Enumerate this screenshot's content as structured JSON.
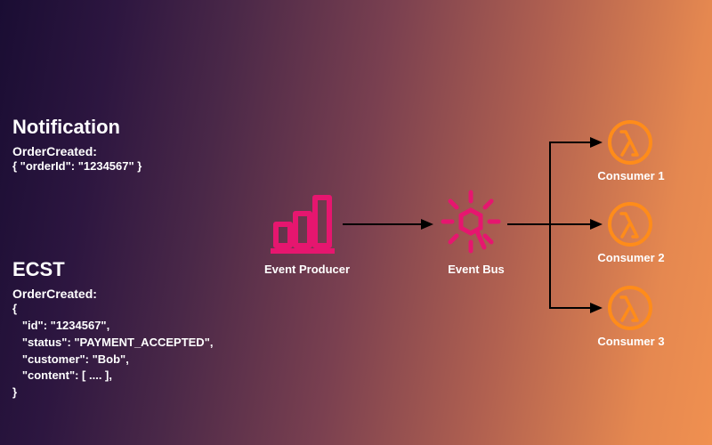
{
  "notification": {
    "heading": "Notification",
    "event_label": "OrderCreated:",
    "payload": "{ \"orderId\": \"1234567\" }"
  },
  "ecst": {
    "heading": "ECST",
    "event_label": "OrderCreated:",
    "payload": "{\n   \"id\": \"1234567\",\n   \"status\": \"PAYMENT_ACCEPTED\",\n   \"customer\": \"Bob\",\n   \"content\": [ .... ],\n}"
  },
  "nodes": {
    "producer_label": "Event Producer",
    "bus_label": "Event Bus"
  },
  "consumers": [
    {
      "label": "Consumer 1"
    },
    {
      "label": "Consumer 2"
    },
    {
      "label": "Consumer 3"
    }
  ],
  "colors": {
    "pink": "#e6166f",
    "orange": "#ff8c1a"
  }
}
